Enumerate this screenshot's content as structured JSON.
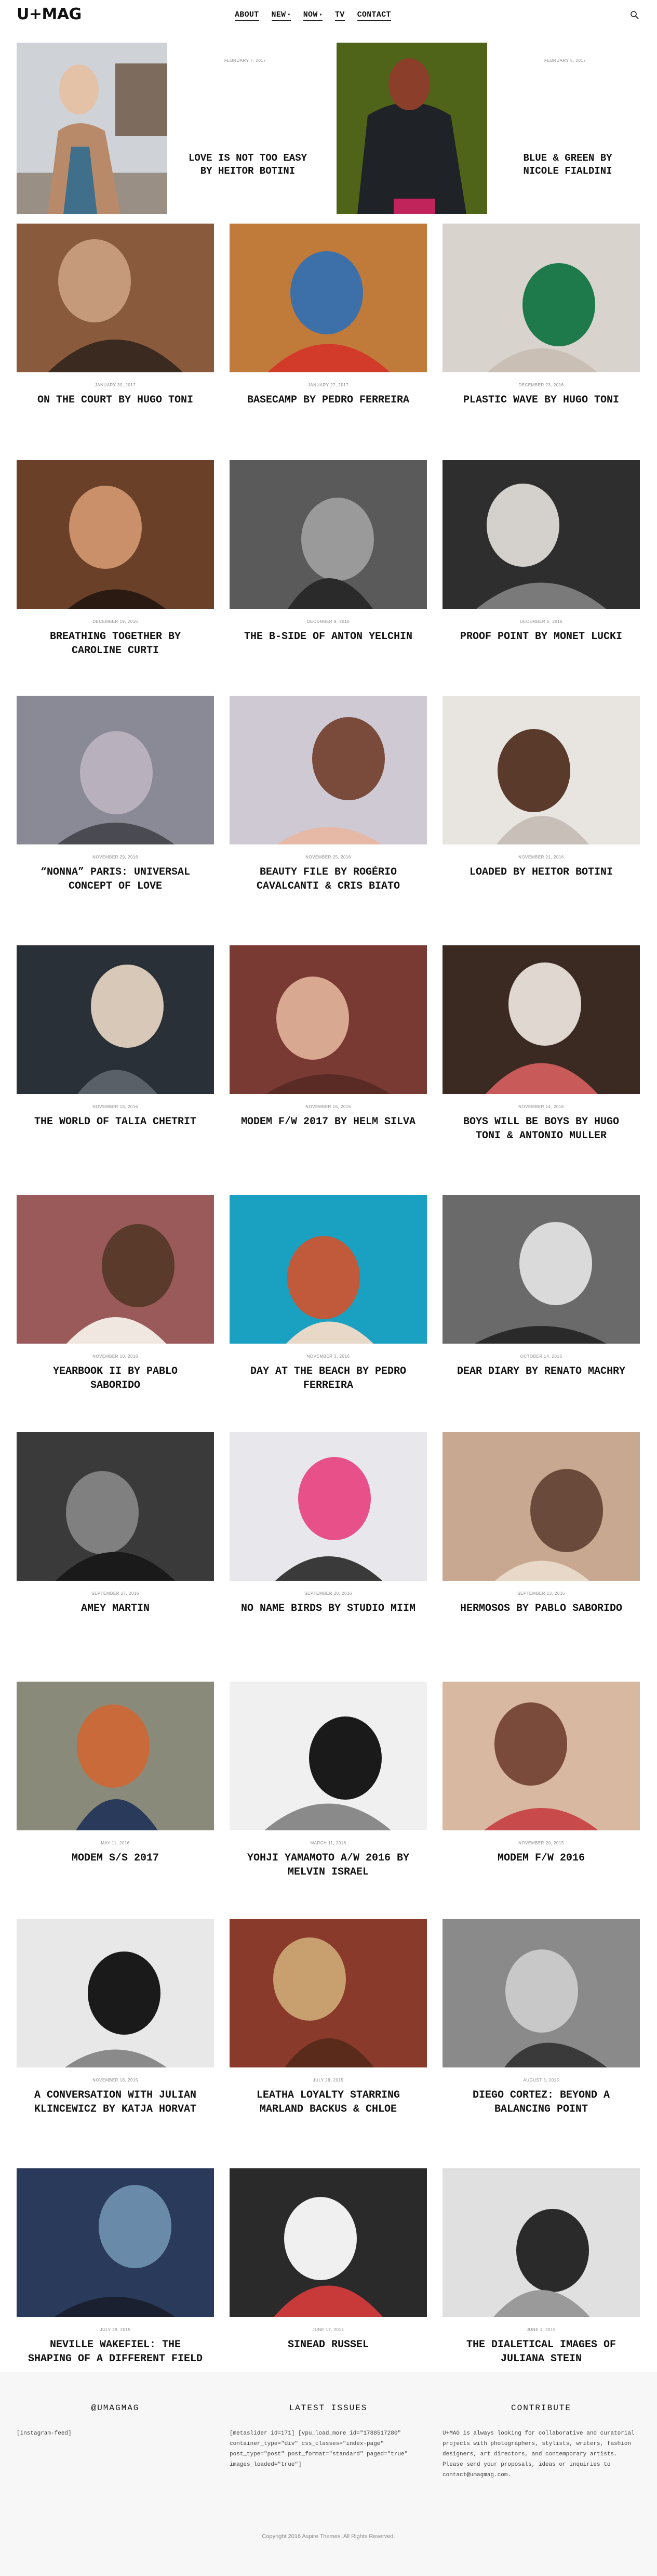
{
  "header": {
    "logo": "U+MAG",
    "nav": [
      {
        "label": "ABOUT",
        "caret": false
      },
      {
        "label": "NEW",
        "caret": true
      },
      {
        "label": "NOW",
        "caret": true
      },
      {
        "label": "TV",
        "caret": false
      },
      {
        "label": "CONTACT",
        "caret": false
      }
    ]
  },
  "featured": [
    {
      "date": "FEBRUARY 7, 2017",
      "title": "LOVE IS NOT TOO EASY BY HEITOR BOTINI"
    },
    {
      "date": "FEBRUARY 5, 2017",
      "title": "BLUE & GREEN BY NICOLE FIALDINI"
    }
  ],
  "articles": [
    {
      "date": "JANUARY 30, 2017",
      "title": "ON THE COURT BY HUGO TONI"
    },
    {
      "date": "JANUARY 27, 2017",
      "title": "BASECAMP BY PEDRO FERREIRA"
    },
    {
      "date": "DECEMBER 23, 2016",
      "title": "PLASTIC WAVE BY HUGO TONI"
    },
    {
      "date": "DECEMBER 19, 2016",
      "title": "BREATHING TOGETHER BY CAROLINE CURTI"
    },
    {
      "date": "DECEMBER 9, 2016",
      "title": "THE B-SIDE OF ANTON YELCHIN"
    },
    {
      "date": "DECEMBER 5, 2016",
      "title": "PROOF POINT BY MONET LUCKI"
    },
    {
      "date": "NOVEMBER 29, 2016",
      "title": "“NONNA” PARIS: UNIVERSAL CONCEPT OF LOVE"
    },
    {
      "date": "NOVEMBER 25, 2016",
      "title": "BEAUTY FILE BY ROGÉRIO CAVALCANTI & CRIS BIATO"
    },
    {
      "date": "NOVEMBER 21, 2016",
      "title": "LOADED BY HEITOR BOTINI"
    },
    {
      "date": "NOVEMBER 18, 2016",
      "title": "THE WORLD OF TALIA CHETRIT"
    },
    {
      "date": "NOVEMBER 16, 2016",
      "title": "MODEM F/W 2017 BY HELM SILVA"
    },
    {
      "date": "NOVEMBER 14, 2016",
      "title": "BOYS WILL BE BOYS BY HUGO TONI & ANTONIO MULLER"
    },
    {
      "date": "NOVEMBER 10, 2016",
      "title": "YEARBOOK II BY PABLO SABORIDO"
    },
    {
      "date": "NOVEMBER 3, 2016",
      "title": "DAY AT THE BEACH BY PEDRO FERREIRA"
    },
    {
      "date": "OCTOBER 14, 2016",
      "title": "DEAR DIARY BY RENATO MACHRY"
    },
    {
      "date": "SEPTEMBER 27, 2016",
      "title": "AMEY MARTIN"
    },
    {
      "date": "SEPTEMBER 20, 2016",
      "title": "NO NAME BIRDS BY STUDIO MIIM"
    },
    {
      "date": "SEPTEMBER 13, 2016",
      "title": "HERMOSOS BY PABLO SABORIDO"
    },
    {
      "date": "MAY 11, 2016",
      "title": "MODEM S/S 2017"
    },
    {
      "date": "MARCH 11, 2016",
      "title": "YOHJI YAMAMOTO A/W 2016 BY MELVIN ISRAEL"
    },
    {
      "date": "NOVEMBER 20, 2015",
      "title": "MODEM F/W 2016"
    },
    {
      "date": "NOVEMBER 18, 2015",
      "title": "A CONVERSATION WITH JULIAN KLINCEWICZ BY KATJA HORVAT"
    },
    {
      "date": "JULY 28, 2015",
      "title": "LEATHA LOYALTY STARRING MARLAND BACKUS & CHLOE"
    },
    {
      "date": "AUGUST 3, 2015",
      "title": "DIEGO CORTEZ: BEYOND A BALANCING POINT"
    },
    {
      "date": "JULY 29, 2015",
      "title": "NEVILLE WAKEFIEL: THE SHAPING OF A DIFFERENT FIELD"
    },
    {
      "date": "JUNE 17, 2015",
      "title": "SINEAD RUSSEL"
    },
    {
      "date": "JUNE 1, 2015",
      "title": "THE DIALETICAL IMAGES OF JULIANA STEIN"
    }
  ],
  "footer": {
    "col1": {
      "heading": "@UMAGMAG",
      "body": "[instagram-feed]"
    },
    "col2": {
      "heading": "LATEST ISSUES",
      "body": "[metaslider id=171] [vpu_load_more id=\"1788517280\" container_type=\"div\" css_classes=\"index-page\" post_type=\"post\" post_format=\"standard\" paged=\"true\" images_loaded=\"true\"]"
    },
    "col3": {
      "heading": "CONTRIBUTE",
      "body": "U+MAG is always looking for collaborative and curatorial projects with photographers, stylists, writers, fashion designers, art directors, and contemporary artists. Please send your proposals, ideas or inquiries to contact@umagmag.com."
    },
    "copyright": "Copyright 2016 Aspire Themes. All Rights Reserved."
  },
  "colors": {
    "text": "#111111",
    "date": "#888888",
    "footer_bg": "#f7f7f7"
  }
}
